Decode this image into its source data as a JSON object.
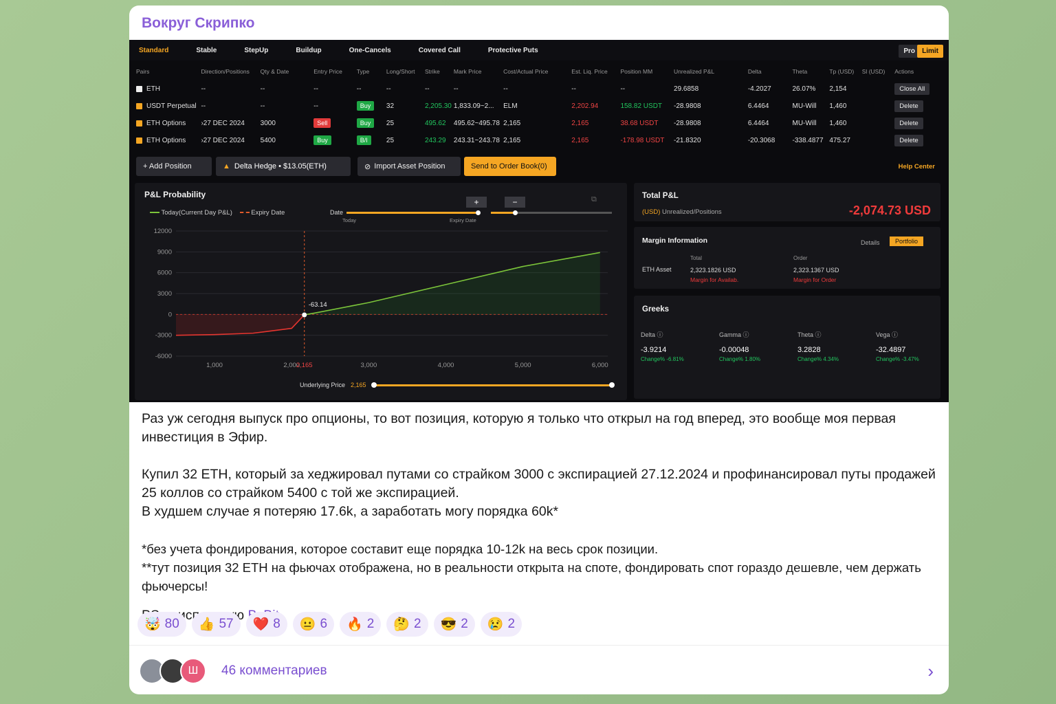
{
  "channel": {
    "name": "Вокруг Скрипко"
  },
  "screenshot": {
    "strategies": [
      "Standard",
      "Stable",
      "StepUp",
      "Buildup",
      "One-Cancels",
      "Covered Call",
      "Protective Puts"
    ],
    "pro_label": "Pro",
    "limit_label": "Limit",
    "columns": [
      "Pairs",
      "Direction/Positions",
      "Qty & Date",
      "Entry Price",
      "Type",
      "Long/Short",
      "Strike",
      "Mark Price",
      "Cost/Actual Price",
      "Est. Liq. Price",
      "Position MM",
      "Unrealized P&L",
      "Delta",
      "Theta",
      "Tp (USD)",
      "Sl (USD)",
      "Actions"
    ],
    "rows": [
      {
        "pair": "ETH",
        "dir": "--",
        "qty": "--",
        "entry": "--",
        "type": "--",
        "ls": "--",
        "strike": "--",
        "mark": "--",
        "cost": "--",
        "liq": "--",
        "mm": "--",
        "pnl": "29.6858",
        "delta": "-4.2027",
        "theta": "26.07%",
        "tp": "2,154",
        "sl": "",
        "action": "Close All"
      },
      {
        "pair": "USDT Perpetual",
        "dir": "--",
        "qty": "--",
        "entry": "--",
        "type": "Buy",
        "ls": "32",
        "strike": "2,205.30",
        "mark": "1,833.09~2...",
        "cost": "ELM",
        "liq": "2,202.94",
        "mm": "158.82 USDT",
        "pnl": "-28.9808",
        "delta": "6.4464",
        "theta": "MU-Will",
        "tp": "1,460",
        "sl": "",
        "action": "Delete"
      },
      {
        "pair": "ETH Options",
        "dir": "›27 DEC 2024",
        "qty": "3000",
        "entry": "Sell",
        "type": "Buy",
        "ls": "25",
        "strike": "495.62",
        "mark": "495.62~495.78",
        "cost": "2,165",
        "liq": "2,165",
        "mm": "38.68 USDT",
        "pnl": "-28.9808",
        "delta": "6.4464",
        "theta": "MU-Will",
        "tp": "1,460",
        "sl": "",
        "action": "Delete"
      },
      {
        "pair": "ETH Options",
        "dir": "›27 DEC 2024",
        "qty": "5400",
        "entry": "Buy",
        "type": "B/I",
        "ls": "25",
        "strike": "243.29",
        "mark": "243.31~243.78",
        "cost": "2,165",
        "liq": "2,165",
        "mm": "-178.98 USDT",
        "pnl": "-21.8320",
        "delta": "-20.3068",
        "theta": "-338.4877",
        "tp": "475.27",
        "sl": "",
        "action": "Delete"
      }
    ],
    "buttons": {
      "add": "+ Add Position",
      "delta": "Delta Hedge  •  $13.05(ETH)",
      "import": "Import Asset Position",
      "send": "Send to Order Book(0)",
      "help": "Help Center"
    },
    "pnl": {
      "title": "P&L Probability",
      "legend_today": "Today(Current Day P&L)",
      "legend_expiry": "Expiry Date",
      "date_label": "Date",
      "today_label": "Today",
      "expiry_label": "Expiry Date",
      "point_label": "-63.14",
      "underlying_label": "Underlying Price",
      "underlying_value": "2,165"
    },
    "total": {
      "title": "Total P&L",
      "sub_cur": "(USD)",
      "sub": "Unrealized/Positions",
      "value": "-2,074.73 USD"
    },
    "margin": {
      "title": "Margin Information",
      "details": "Details",
      "portfolio": "Portfolio",
      "asset": "ETH Asset",
      "total_h": "Total",
      "order_h": "Order",
      "total_v": "2,323.1826 USD",
      "order_v": "2,323.1367 USD",
      "total_note": "Margin for Availab.",
      "order_note": "Margin for Order"
    },
    "greeks": {
      "title": "Greeks",
      "items": [
        {
          "name": "Delta",
          "value": "-3.9214",
          "change": "Change% -6.81%"
        },
        {
          "name": "Gamma",
          "value": "-0.00048",
          "change": "Change% 1.80%"
        },
        {
          "name": "Theta",
          "value": "3.2828",
          "change": "Change% 4.34%"
        },
        {
          "name": "Vega",
          "value": "-32.4897",
          "change": "Change% -3.47%"
        }
      ]
    }
  },
  "chart_data": {
    "type": "line",
    "xlabel": "Underlying Price",
    "x_ticks": [
      "1,000",
      "2,000",
      "2,165",
      "3,000",
      "4,000",
      "5,000",
      "6,000"
    ],
    "y_ticks": [
      "12000",
      "9000",
      "6000",
      "3000",
      "0",
      "-3000",
      "-6000"
    ],
    "ylim": [
      -6000,
      12000
    ],
    "xlim": [
      500,
      6100
    ],
    "series": [
      {
        "name": "Today(Current Day P&L)",
        "x": [
          500,
          1000,
          1500,
          2000,
          2165,
          2300,
          3000,
          4000,
          5000,
          6000
        ],
        "values": [
          -3000,
          -2900,
          -2700,
          -2000,
          -63,
          200,
          1700,
          4300,
          6900,
          8900
        ]
      }
    ],
    "marker": {
      "x": 2165,
      "y": -63.14
    }
  },
  "post": {
    "p1": "Раз уж сегодня выпуск про опционы, то вот позиция, которую я только что открыл на год вперед, это вообще моя первая инвестиция в Эфир.",
    "p2a": "Купил 32 ETH, который за хеджировал путами со страйком  3000 с экспирацией 27.12.2024 и профинансировал путы продажей 25 коллов со страйком 5400 с той же экспирацией.",
    "p2b": "В худшем случае я потеряю 17.6k, а заработать могу порядка 60k*",
    "p3a": "*без учета фондирования, которое составит еще порядка 10-12k на весь срок позиции.",
    "p3b": "**тут позиция 32 ETH на фьючах отображена, но в реальности открыта на споте, фондировать спот гораздо дешевле, чем держать фьючерсы!",
    "ps_prefix": "PS: я использую ",
    "ps_link": "ByBit"
  },
  "reactions": [
    {
      "emoji": "🤯",
      "count": "80"
    },
    {
      "emoji": "👍",
      "count": "57"
    },
    {
      "emoji": "❤️",
      "count": "8"
    },
    {
      "emoji": "😐",
      "count": "6"
    },
    {
      "emoji": "🔥",
      "count": "2"
    },
    {
      "emoji": "🤔",
      "count": "2"
    },
    {
      "emoji": "😎",
      "count": "2"
    },
    {
      "emoji": "😢",
      "count": "2"
    }
  ],
  "footer": {
    "comments": "46 комментариев",
    "avatar_letter": "Ш"
  }
}
